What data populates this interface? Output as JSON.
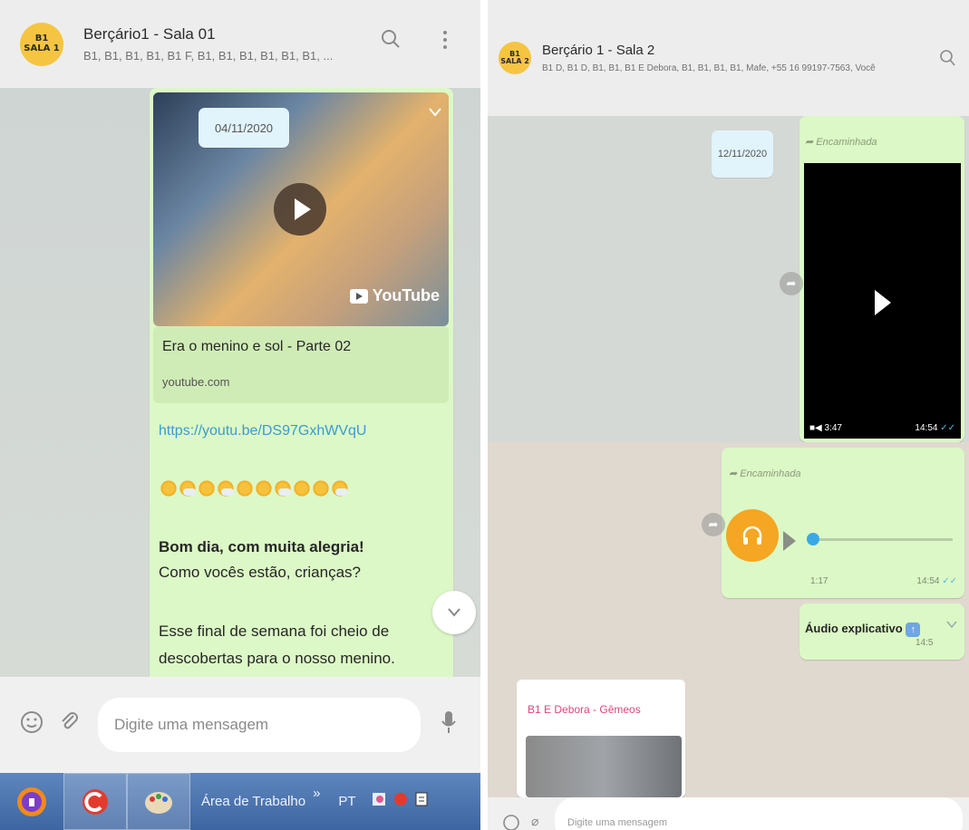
{
  "left": {
    "header": {
      "avatar_line1": "B1",
      "avatar_line2": "SALA 1",
      "title": "Berçário1 - Sala 01",
      "subtitle": "B1, B1, B1, B1, B1 F, B1, B1, B1, B1, B1, B1, ...",
      "search_icon": "search-icon",
      "menu_icon": "more-vertical-icon"
    },
    "message": {
      "date": "04/11/2020",
      "youtube_label": "YouTube",
      "link_title": "Era o menino e sol - Parte 02",
      "link_domain": "youtube.com",
      "url": "https://youtu.be/DS97GxhWVqU",
      "greeting": "Bom dia, com muita alegria!",
      "line1": "Como vocês estão, crianças?",
      "line2": "Esse final de semana foi cheio de",
      "line3": "descobertas para o nosso menino."
    },
    "footer": {
      "placeholder": "Digite uma mensagem"
    },
    "taskbar": {
      "area_label": "Área de Trabalho",
      "chevron": "»",
      "lang": "PT"
    }
  },
  "right": {
    "header": {
      "avatar_line1": "B1",
      "avatar_line2": "SALA 2",
      "title": "Berçário 1 - Sala 2",
      "subtitle": "B1 D, B1 D, B1, B1, B1 E Debora, B1, B1, B1, B1, Mafe, +55 16 99197-7563, Você"
    },
    "messages": {
      "date": "12/11/2020",
      "forwarded_label": "Encaminhada",
      "video_duration": "3:47",
      "video_time": "14:54",
      "audio_duration": "1:17",
      "audio_time": "14:54",
      "caption": "Áudio explicativo",
      "caption_time": "14:5",
      "sender": "B1 E Debora - Gêmeos"
    },
    "footer": {
      "placeholder": "Digite uma mensagem"
    }
  },
  "colors": {
    "bubble_out": "#dcf8c6",
    "date_pill": "#e1f3fb",
    "audio_orange": "#f5a623",
    "link_blue": "#3a9bd1",
    "sender_pink": "#e0457b"
  }
}
